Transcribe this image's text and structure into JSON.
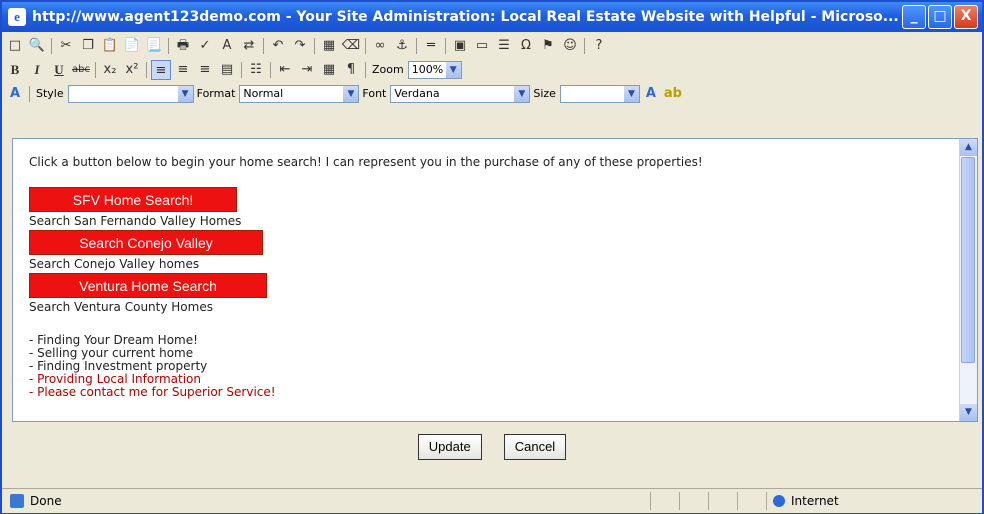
{
  "window": {
    "title": "http://www.agent123demo.com - Your Site Administration: Local Real Estate Website with Helpful - Microso...",
    "minimize": "_",
    "maximize": "□",
    "close": "X"
  },
  "toolbar": {
    "zoom_label": "Zoom",
    "zoom_value": "100%",
    "style_label": "Style",
    "style_value": "",
    "format_label": "Format",
    "format_value": "Normal",
    "font_label": "Font",
    "font_value": "Verdana",
    "size_label": "Size",
    "size_value": ""
  },
  "editor": {
    "intro": "Click a button below to begin your home search! I can represent you in the purchase of any of these properties!",
    "buttons": [
      {
        "label": "SFV Home Search!",
        "caption": "Search San Fernando Valley Homes"
      },
      {
        "label": "Search Conejo Valley",
        "caption": "Search Conejo Valley homes"
      },
      {
        "label": "Ventura Home Search",
        "caption": "Search Ventura County Homes"
      }
    ],
    "list": [
      "- Finding Your Dream Home!",
      "- Selling your current home",
      "- Finding Investment property",
      "- Providing Local Information",
      "- Please contact me for Superior Service!"
    ]
  },
  "actions": {
    "update": "Update",
    "cancel": "Cancel"
  },
  "status": {
    "text": "Done",
    "zone": "Internet"
  }
}
